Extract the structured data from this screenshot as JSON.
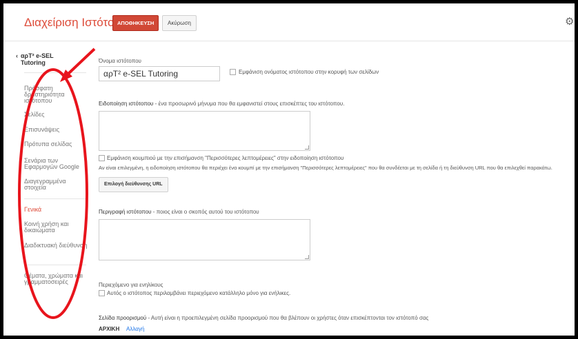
{
  "header": {
    "title": "Διαχείριση Ιστότοπου",
    "save_label": "ΑΠΟΘΗΚΕΥΣΗ",
    "cancel_label": "Ακύρωση"
  },
  "sidebar": {
    "site_name": "αρΤ² e-SEL Tutoring",
    "items": [
      {
        "label": "Πρόσφατη δραστηριότητα ιστότοπου"
      },
      {
        "label": "Σελίδες"
      },
      {
        "label": "Επισυνάψεις"
      },
      {
        "label": "Πρότυπα σελίδας"
      },
      {
        "label": "Σενάρια των Εφαρμογών Google"
      },
      {
        "label": "Διαγεγραμμένα στοιχεία"
      },
      {
        "label": "Γενικά"
      },
      {
        "label": "Κοινή χρήση και δικαιώματα"
      },
      {
        "label": "Διαδικτυακή διεύθυνση"
      },
      {
        "label": "Θέματα, χρώματα και γραμματοσειρές"
      }
    ]
  },
  "main": {
    "site_name_label": "Όνομα ιστότοπου",
    "site_name_value": "αρΤ² e-SEL Tutoring",
    "show_name_label": "Εμφάνιση ονόματος ιστότοπου στην κορυφή των σελίδων",
    "notice_title": "Ειδοποίηση ιστότοπου",
    "notice_desc": " - ένα προσωρινό μήνυμα που θα εμφανιστεί στους επισκέπτες του ιστότοπου.",
    "more_details_check": "Εμφάνιση κουμπιού με την επισήμανση \"Περισσότερες λεπτομέρειες\" στην ειδοποίηση ιστότοπου",
    "more_details_help": "Αν είναι επιλεγμένη, η ειδοποίηση ιστότοπου θα περιέχει ένα κουμπί με την επισήμανση \"Περισσότερες λεπτομέρειες\" που θα συνδέεται με τη σελίδα ή τη διεύθυνση URL που θα επιλεχθεί παρακάτω.",
    "choose_url_label": "Επιλογή διεύθυνσης URL",
    "description_title": "Περιγραφή ιστότοπου",
    "description_desc": " - ποιος είναι ο σκοπός αυτού του ιστότοπου",
    "adult_title": "Περιεχόμενο για ενηλίκους",
    "adult_check": "Αυτός ο ιστότοπος περιλαμβάνει περιεχόμενο κατάλληλο μόνο για ενήλικες.",
    "landing_title": "Σελίδα προορισμού",
    "landing_desc": " - Αυτή είναι η προεπιλεγμένη σελίδα προορισμού που θα βλέπουν οι χρήστες όταν επισκέπτονται τον ιστότοπό σας",
    "landing_value": "ΑΡΧΙΚΗ",
    "change_link": "Αλλαγή"
  },
  "colors": {
    "accent": "#dd4b39",
    "annotation": "#e8141c",
    "link": "#1a73e8"
  },
  "icons": [
    "gear-icon",
    "chevron-left-icon",
    "checkbox-icon",
    "resize-handle-icon"
  ]
}
